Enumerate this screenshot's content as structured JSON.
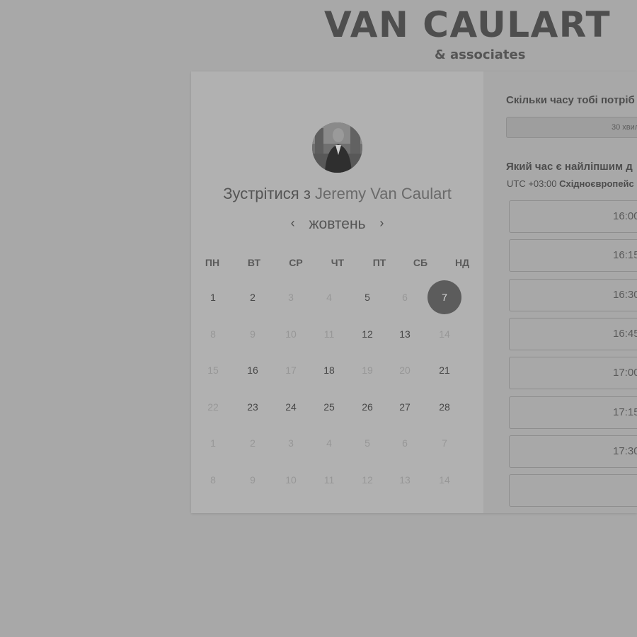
{
  "brand": {
    "title": "VAN CAULART",
    "subtitle": "& associates"
  },
  "meeting": {
    "prefix": "Зустрітися з",
    "host": "Jeremy Van Caulart"
  },
  "calendar": {
    "month": "жовтень",
    "weekdays": [
      "ПН",
      "ВТ",
      "СР",
      "ЧТ",
      "ПТ",
      "СБ",
      "НД"
    ],
    "weeks": [
      [
        {
          "d": "1",
          "s": "avail"
        },
        {
          "d": "2",
          "s": "avail"
        },
        {
          "d": "3",
          "s": "dim"
        },
        {
          "d": "4",
          "s": "dim"
        },
        {
          "d": "5",
          "s": "avail"
        },
        {
          "d": "6",
          "s": "dim"
        },
        {
          "d": "7",
          "s": "selected"
        }
      ],
      [
        {
          "d": "8",
          "s": "dim"
        },
        {
          "d": "9",
          "s": "dim"
        },
        {
          "d": "10",
          "s": "dim"
        },
        {
          "d": "11",
          "s": "dim"
        },
        {
          "d": "12",
          "s": "avail"
        },
        {
          "d": "13",
          "s": "avail"
        },
        {
          "d": "14",
          "s": "dim"
        }
      ],
      [
        {
          "d": "15",
          "s": "dim"
        },
        {
          "d": "16",
          "s": "avail"
        },
        {
          "d": "17",
          "s": "dim"
        },
        {
          "d": "18",
          "s": "avail"
        },
        {
          "d": "19",
          "s": "dim"
        },
        {
          "d": "20",
          "s": "dim"
        },
        {
          "d": "21",
          "s": "avail"
        }
      ],
      [
        {
          "d": "22",
          "s": "dim"
        },
        {
          "d": "23",
          "s": "avail"
        },
        {
          "d": "24",
          "s": "avail"
        },
        {
          "d": "25",
          "s": "avail"
        },
        {
          "d": "26",
          "s": "avail"
        },
        {
          "d": "27",
          "s": "avail"
        },
        {
          "d": "28",
          "s": "avail"
        }
      ],
      [
        {
          "d": "1",
          "s": "dim"
        },
        {
          "d": "2",
          "s": "dim"
        },
        {
          "d": "3",
          "s": "dim"
        },
        {
          "d": "4",
          "s": "dim"
        },
        {
          "d": "5",
          "s": "dim"
        },
        {
          "d": "6",
          "s": "dim"
        },
        {
          "d": "7",
          "s": "dim"
        }
      ],
      [
        {
          "d": "8",
          "s": "dim"
        },
        {
          "d": "9",
          "s": "dim"
        },
        {
          "d": "10",
          "s": "dim"
        },
        {
          "d": "11",
          "s": "dim"
        },
        {
          "d": "12",
          "s": "dim"
        },
        {
          "d": "13",
          "s": "dim"
        },
        {
          "d": "14",
          "s": "dim"
        }
      ]
    ]
  },
  "scheduler": {
    "duration_label": "Скільки часу тобі потріб",
    "duration_value": "30 хвил",
    "best_time_label": "Який час є найліпшим д",
    "tz_offset": "UTC +03:00",
    "tz_name": "Східноєвропейс",
    "slots": [
      "16:00",
      "16:15",
      "16:30",
      "16:45",
      "17:00",
      "17:15",
      "17:30"
    ]
  },
  "colors": {
    "background": "#a8a8a8",
    "calendar_panel": "#b1b1b1",
    "selected_day": "#5c5c5c"
  }
}
